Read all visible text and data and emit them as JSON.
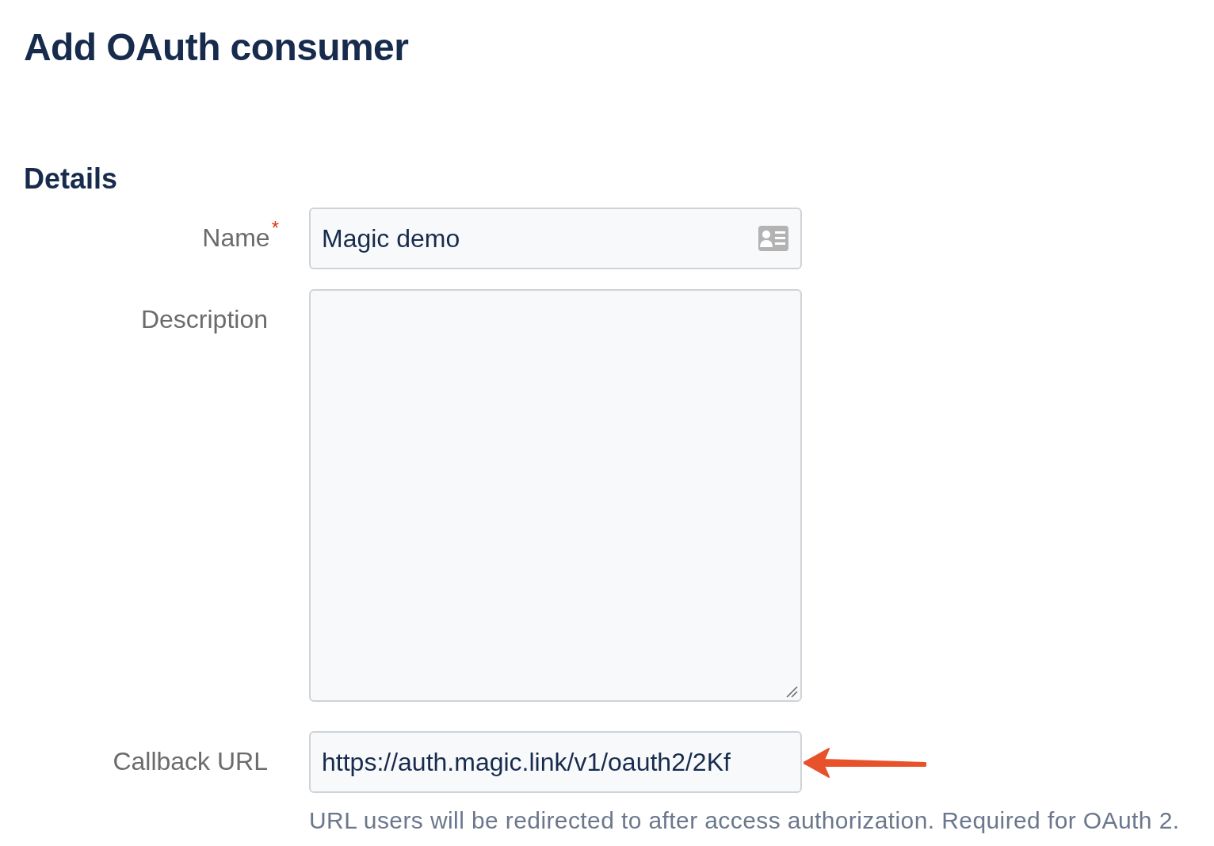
{
  "page": {
    "title": "Add OAuth consumer"
  },
  "section": {
    "heading": "Details"
  },
  "fields": [
    {
      "kind": "autofill",
      "label": "Name",
      "required_mark": "*",
      "value": "Magic demo"
    },
    {
      "kind": "textarea",
      "label": "Description"
    },
    {
      "kind": "annotated",
      "label": "Callback URL",
      "value": "https://auth.magic.link/v1/oauth2/2Kf",
      "help": "URL users will be redirected to after access authorization. Required for OAuth 2."
    }
  ]
}
